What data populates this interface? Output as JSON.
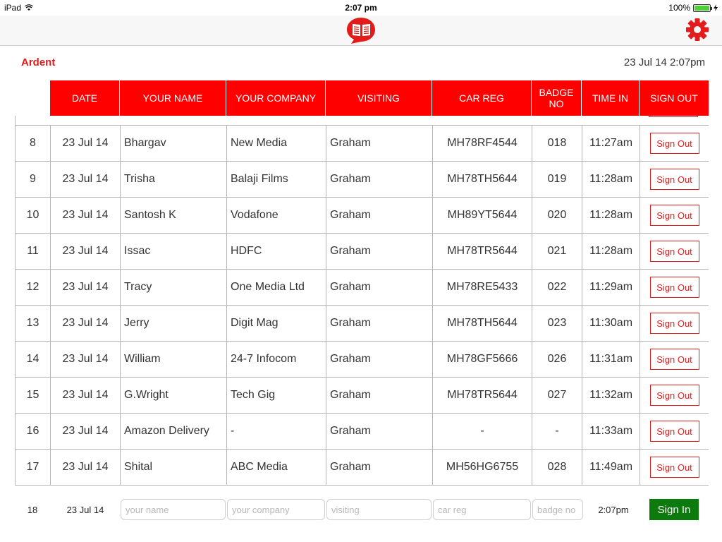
{
  "status_bar": {
    "device": "iPad",
    "time": "2:07 pm",
    "battery": "100%",
    "battery_level": 1.0
  },
  "nav": {
    "logo_icon": "open-book-icon",
    "settings_icon": "gear-icon",
    "accent_color": "#e31b1b"
  },
  "header": {
    "organization": "Ardent",
    "datetime": "23 Jul 14 2:07pm"
  },
  "table": {
    "columns": [
      "DATE",
      "YOUR NAME",
      "YOUR COMPANY",
      "VISITING",
      "CAR REG",
      "BADGE NO",
      "TIME IN",
      "SIGN OUT"
    ],
    "rows": [
      {
        "num": "8",
        "date": "23 Jul 14",
        "name": "Bhargav",
        "company": "New Media",
        "visiting": "Graham",
        "car_reg": "MH78RF4544",
        "badge": "018",
        "time_in": "11:27am",
        "action": "Sign Out"
      },
      {
        "num": "9",
        "date": "23 Jul 14",
        "name": "Trisha",
        "company": "Balaji Films",
        "visiting": "Graham",
        "car_reg": "MH78TH5644",
        "badge": "019",
        "time_in": "11:28am",
        "action": "Sign Out"
      },
      {
        "num": "10",
        "date": "23 Jul 14",
        "name": "Santosh K",
        "company": "Vodafone",
        "visiting": "Graham",
        "car_reg": "MH89YT5644",
        "badge": "020",
        "time_in": "11:28am",
        "action": "Sign Out"
      },
      {
        "num": "11",
        "date": "23 Jul 14",
        "name": "Issac",
        "company": "HDFC",
        "visiting": "Graham",
        "car_reg": "MH78TR5644",
        "badge": "021",
        "time_in": "11:28am",
        "action": "Sign Out"
      },
      {
        "num": "12",
        "date": "23 Jul 14",
        "name": "Tracy",
        "company": "One Media Ltd",
        "visiting": "Graham",
        "car_reg": "MH78RE5433",
        "badge": "022",
        "time_in": "11:29am",
        "action": "Sign Out"
      },
      {
        "num": "13",
        "date": "23 Jul 14",
        "name": "Jerry",
        "company": "Digit Mag",
        "visiting": "Graham",
        "car_reg": "MH78TH5644",
        "badge": "023",
        "time_in": "11:30am",
        "action": "Sign Out"
      },
      {
        "num": "14",
        "date": "23 Jul 14",
        "name": "William",
        "company": "24-7 Infocom",
        "visiting": "Graham",
        "car_reg": "MH78GF5666",
        "badge": "026",
        "time_in": "11:31am",
        "action": "Sign Out"
      },
      {
        "num": "15",
        "date": "23 Jul 14",
        "name": "G.Wright",
        "company": "Tech Gig",
        "visiting": "Graham",
        "car_reg": "MH78TR5644",
        "badge": "027",
        "time_in": "11:32am",
        "action": "Sign Out"
      },
      {
        "num": "16",
        "date": "23 Jul 14",
        "name": "Amazon Delivery",
        "company": "-",
        "visiting": "Graham",
        "car_reg": "-",
        "badge": "-",
        "time_in": "11:33am",
        "action": "Sign Out"
      },
      {
        "num": "17",
        "date": "23 Jul 14",
        "name": "Shital",
        "company": "ABC Media",
        "visiting": "Graham",
        "car_reg": "MH56HG6755",
        "badge": "028",
        "time_in": "11:49am",
        "action": "Sign Out"
      }
    ]
  },
  "entry": {
    "num": "18",
    "date": "23 Jul 14",
    "name_placeholder": "your name",
    "company_placeholder": "your company",
    "visiting_placeholder": "visiting",
    "car_reg_placeholder": "car reg",
    "badge_placeholder": "badge no",
    "time": "2:07pm",
    "sign_in_label": "Sign In",
    "sign_in_color": "#0c7a0c"
  }
}
